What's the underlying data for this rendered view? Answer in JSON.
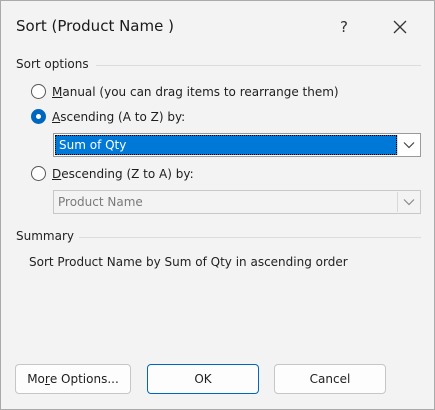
{
  "window": {
    "title": "Sort (Product Name )",
    "help_label": "?"
  },
  "sort_options": {
    "header": "Sort options",
    "manual": {
      "prefix": "",
      "accel": "M",
      "rest": "anual (you can drag items to rearrange them)",
      "checked": false
    },
    "ascending": {
      "prefix": "",
      "accel": "A",
      "rest": "scending (A to Z) by:",
      "checked": true
    },
    "ascending_field": {
      "value": "Sum of Qty"
    },
    "descending": {
      "prefix": "",
      "accel": "D",
      "rest": "escending (Z to A) by:",
      "checked": false
    },
    "descending_field": {
      "value": "Product Name"
    }
  },
  "summary": {
    "header": "Summary",
    "text": "Sort Product Name  by Sum of Qty in ascending order"
  },
  "buttons": {
    "more_options": {
      "prefix": "Mo",
      "accel": "r",
      "rest": "e Options..."
    },
    "ok": "OK",
    "cancel": "Cancel"
  },
  "colors": {
    "accent": "#0067c0",
    "selection": "#0078d7"
  },
  "icons": {
    "close": "close-icon",
    "dropdown": "chevron-down-icon"
  }
}
